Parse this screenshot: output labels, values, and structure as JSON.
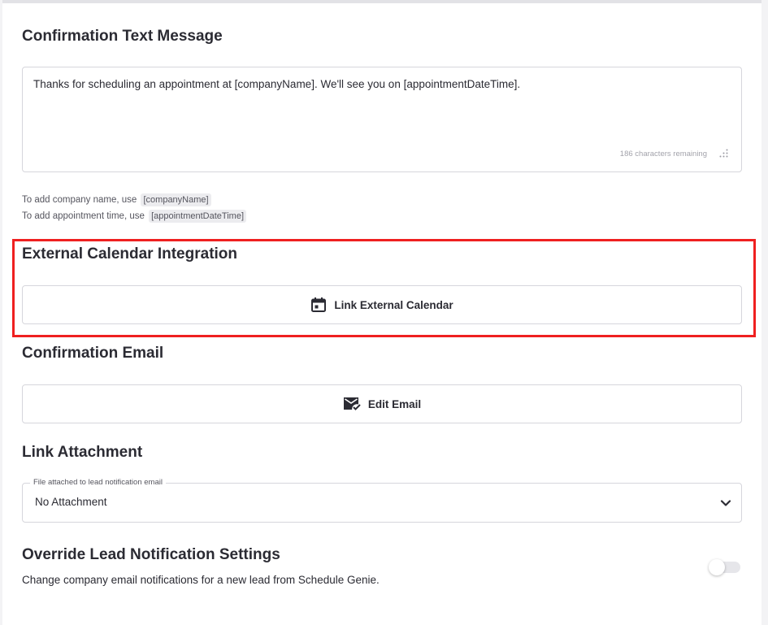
{
  "confirmation_text": {
    "title": "Confirmation Text Message",
    "message": "Thanks for scheduling an appointment at [companyName]. We'll see you on [appointmentDateTime].",
    "char_remaining": "186 characters remaining",
    "hint_company_prefix": "To add company name, use",
    "hint_company_token": "[companyName]",
    "hint_time_prefix": "To add appointment time, use",
    "hint_time_token": "[appointmentDateTime]"
  },
  "external_calendar": {
    "title": "External Calendar Integration",
    "button_label": "Link External Calendar",
    "icon": "calendar-icon"
  },
  "confirmation_email": {
    "title": "Confirmation Email",
    "button_label": "Edit Email",
    "icon": "email-check-icon"
  },
  "link_attachment": {
    "title": "Link Attachment",
    "select_label": "File attached to lead notification email",
    "selected_value": "No Attachment",
    "icon": "chevron-down-icon"
  },
  "override_notifications": {
    "title": "Override Lead Notification Settings",
    "description": "Change company email notifications for a new lead from Schedule Genie.",
    "toggle_on": false
  },
  "colors": {
    "highlight": "#ef2020",
    "text": "#2b2b33",
    "border": "#d6d6dc"
  }
}
